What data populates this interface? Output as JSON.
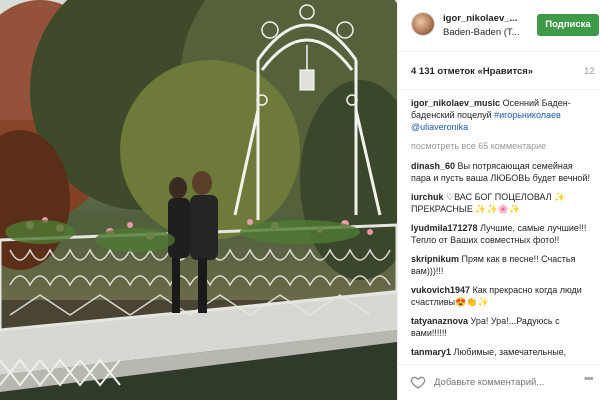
{
  "post": {
    "username": "igor_nikolaev_...",
    "location": "Baden-Baden (T...",
    "follow_label": "Подписка",
    "likes": "4 131 отметок «Нравится»",
    "time": "12",
    "caption_user": "igor_nikolaev_music",
    "caption_text": "Осенний Баден-баденский поцелуй",
    "caption_hashtag": "#игорьниколаев",
    "caption_mention": "@uliaveronika",
    "view_all": "посмотреть все 65 комментарие",
    "add_comment_placeholder": "Добавьте комментарий...",
    "more": "•••"
  },
  "comments": [
    {
      "user": "dinash_60",
      "text": "Вы потрясающая семейная пара и пусть ваша ЛЮБОВЬ будет вечной!"
    },
    {
      "user": "iurchuk",
      "text": "♡ВАС БОГ ПОЦЕЛОВАЛ ✨ ПРЕКРАСНЫЕ ✨✨🌸✨"
    },
    {
      "user": "lyudmila171278",
      "text": "Лучшие, самые лучшие!!! Тепло от Ваших совместных фото!!"
    },
    {
      "user": "skripnikum",
      "text": "Прям как в песне!! Счастья вам)))!!!"
    },
    {
      "user": "vukovich1947",
      "text": "Как прекрасно когда люди счастливы😍👏✨"
    },
    {
      "user": "tatyanaznova",
      "text": "Ура! Ура!...Радуюсь с вами!!!!!!"
    },
    {
      "user": "tanmary1",
      "text": "Любимые, замечательные,"
    }
  ],
  "colors": {
    "follow_bg": "#3f9a4a",
    "link": "#1e5aa8",
    "muted": "#999999"
  },
  "icons": {
    "heart": "heart-outline-icon"
  }
}
